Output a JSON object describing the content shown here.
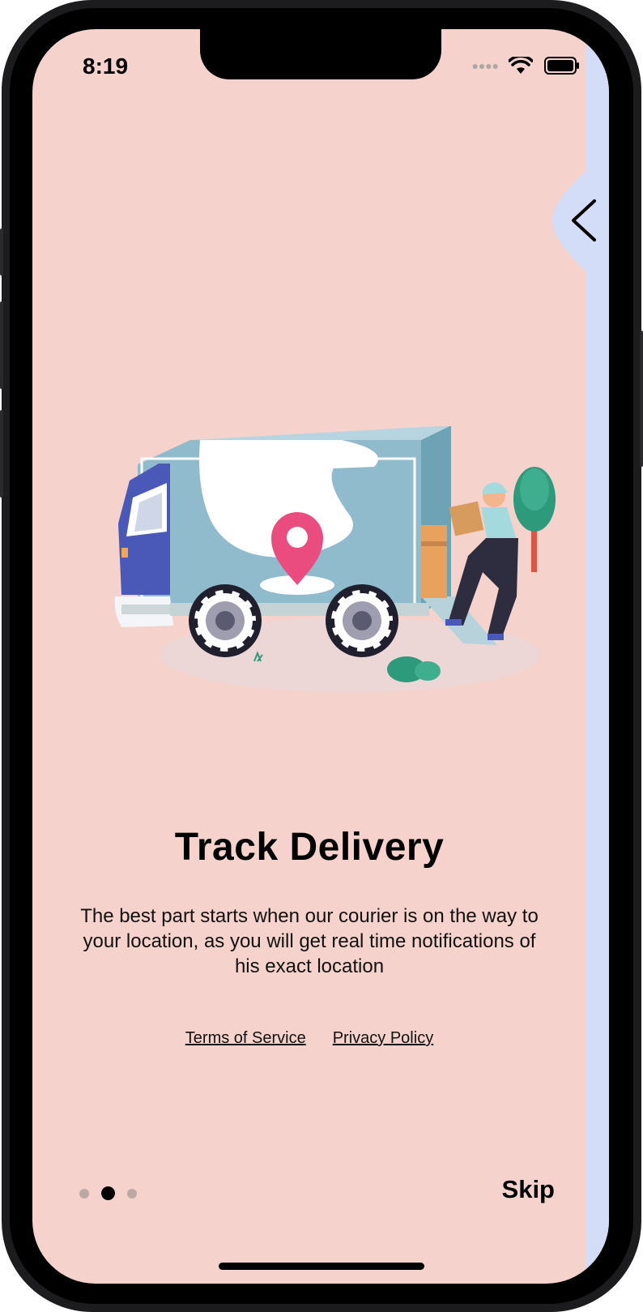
{
  "status_bar": {
    "time": "8:19"
  },
  "onboarding": {
    "title": "Track Delivery",
    "description": "The best part starts when our courier is on the way to your location, as you will get real time notifications of his exact location",
    "terms_label": "Terms of Service",
    "privacy_label": "Privacy Policy",
    "skip_label": "Skip",
    "page_count": 3,
    "current_page": 2
  },
  "colors": {
    "background": "#f5d3cc",
    "next_panel": "#d4ddf7",
    "pin": "#ea4c7f",
    "truck": "#8fbbcd",
    "cab": "#4a58b8",
    "tree": "#2e9a7c"
  },
  "icons": [
    "wifi-icon",
    "battery-icon",
    "chevron-left-icon",
    "location-pin-icon"
  ]
}
